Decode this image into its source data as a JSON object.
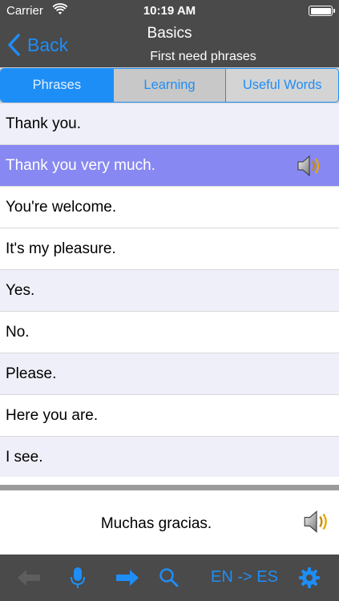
{
  "status_bar": {
    "carrier": "Carrier",
    "time": "10:19 AM"
  },
  "nav": {
    "back_label": "Back",
    "title": "Basics",
    "subtitle": "First need phrases"
  },
  "tabs": [
    {
      "label": "Phrases",
      "selected": true
    },
    {
      "label": "Learning",
      "selected": false
    },
    {
      "label": "Useful Words",
      "selected": false
    }
  ],
  "phrases": [
    "Thank you.",
    "Thank you very much.",
    "You're welcome.",
    "It's my pleasure.",
    "Yes.",
    "No.",
    "Please.",
    "Here you are.",
    "I see."
  ],
  "selected_phrase_index": 1,
  "translation": {
    "text": "Muchas gracias."
  },
  "toolbar": {
    "icons": [
      "back-arrow-icon",
      "microphone-icon",
      "forward-arrow-icon",
      "search-icon",
      "settings-gear-icon"
    ],
    "language_toggle": "EN -> ES"
  },
  "colors": {
    "accent": "#1e8ef7",
    "bar_background": "#4a4a4a",
    "selected_row": "#8888f2",
    "row_tint": "#efeff9"
  }
}
